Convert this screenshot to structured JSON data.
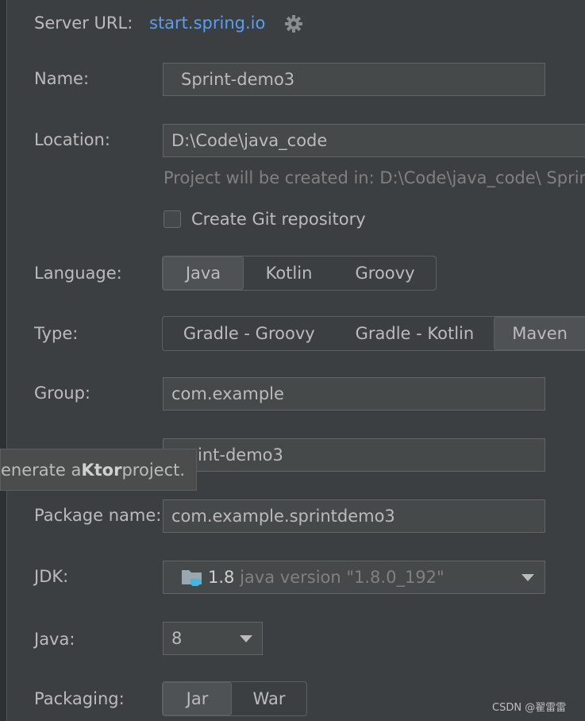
{
  "server_url": {
    "label": "Server URL:",
    "link": "start.spring.io"
  },
  "name": {
    "label": "Name:",
    "value": "Sprint-demo3"
  },
  "location": {
    "label": "Location:",
    "value": "D:\\Code\\java_code",
    "hint": "Project will be created in: D:\\Code\\java_code\\ Sprint-"
  },
  "git": {
    "label": "Create Git repository"
  },
  "language": {
    "label": "Language:",
    "options": [
      "Java",
      "Kotlin",
      "Groovy"
    ],
    "selected": "Java"
  },
  "type": {
    "label": "Type:",
    "options": [
      "Gradle - Groovy",
      "Gradle - Kotlin",
      "Maven"
    ],
    "selected": "Maven"
  },
  "group": {
    "label": "Group:",
    "value": "com.example"
  },
  "artifact": {
    "value": "int-demo3"
  },
  "tooltip": {
    "prefix": "enerate a ",
    "bold": "Ktor",
    "suffix": " project."
  },
  "package": {
    "label": "Package name:",
    "value": "com.example.sprintdemo3"
  },
  "jdk": {
    "label": "JDK:",
    "version": "1.8",
    "detail": "java version \"1.8.0_192\""
  },
  "java": {
    "label": "Java:",
    "value": "8"
  },
  "packaging": {
    "label": "Packaging:",
    "options": [
      "Jar",
      "War"
    ],
    "selected": "Jar"
  },
  "watermark": "CSDN @翟雷雷"
}
